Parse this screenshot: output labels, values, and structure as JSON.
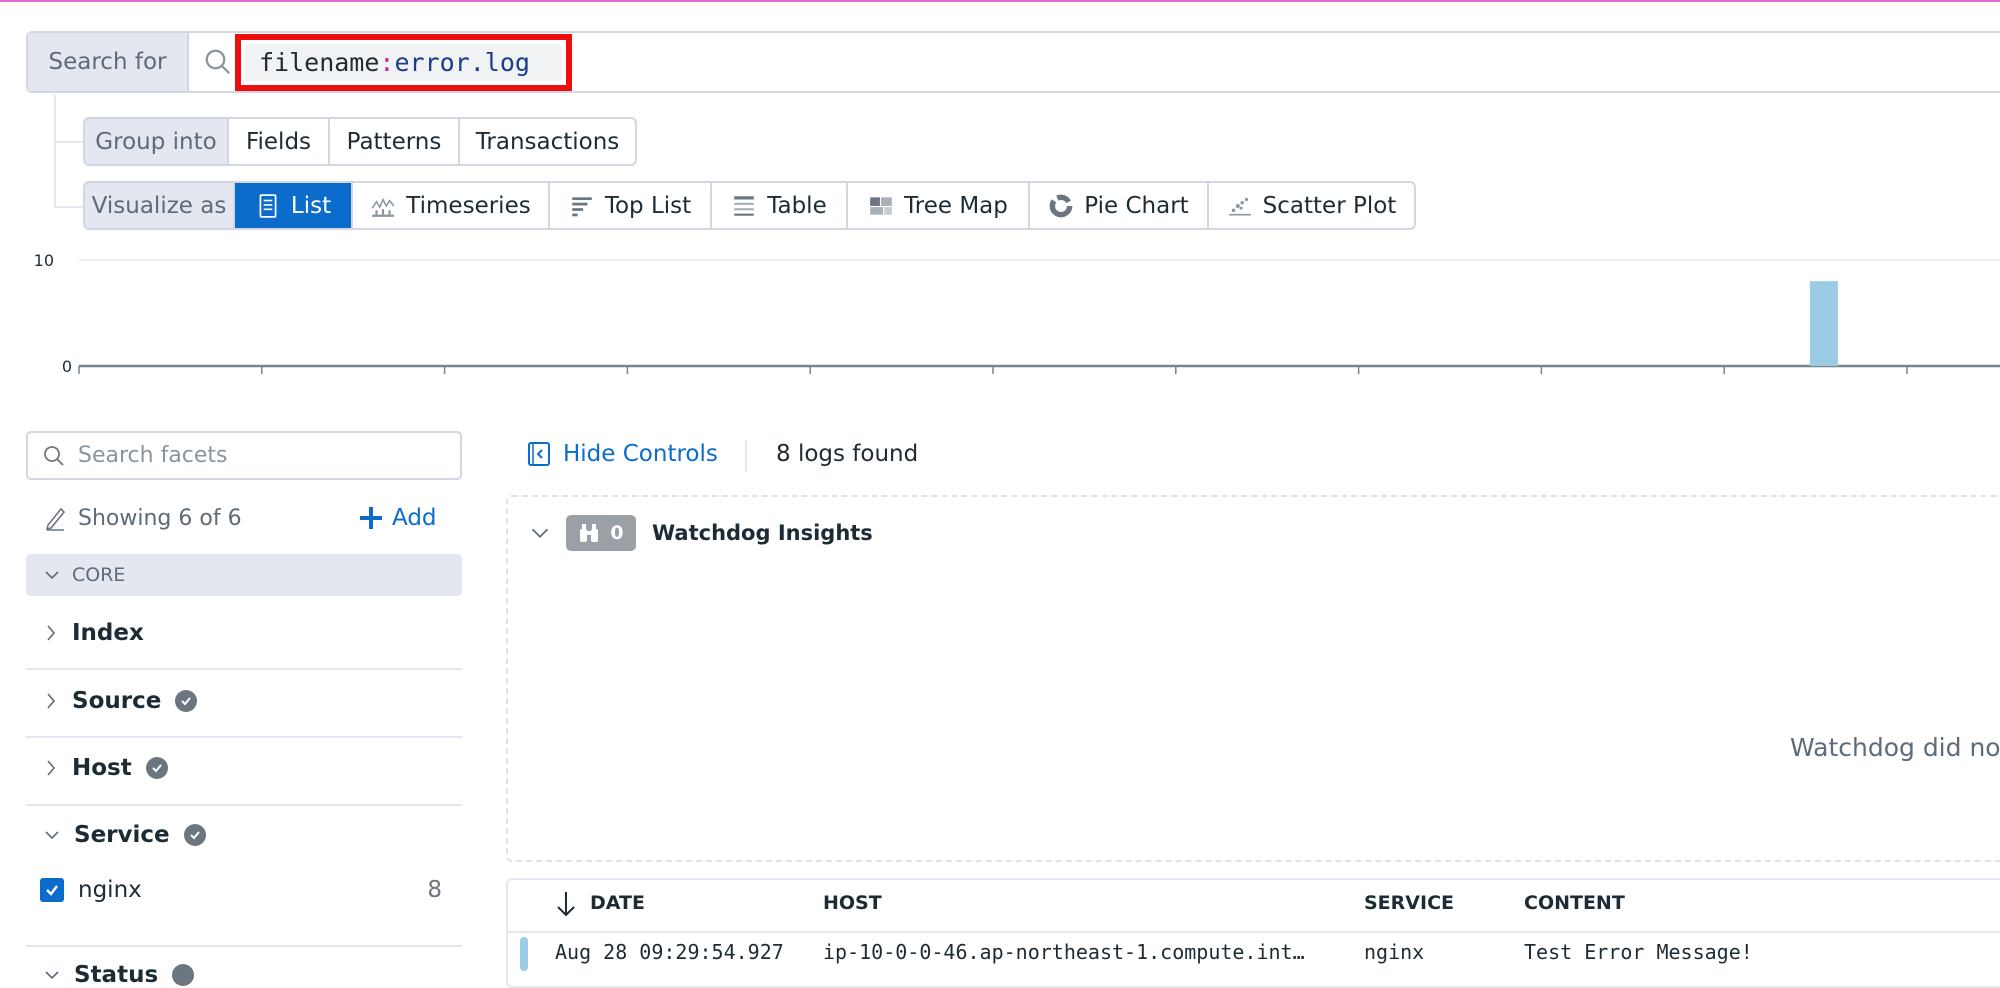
{
  "search": {
    "label": "Search for",
    "query_key": "filename",
    "query_sep": ":",
    "query_value": "error.log"
  },
  "group_into": {
    "label": "Group into",
    "options": [
      "Fields",
      "Patterns",
      "Transactions"
    ]
  },
  "visualize_as": {
    "label": "Visualize as",
    "selected": "List",
    "options": [
      {
        "label": "List",
        "icon": "list-icon"
      },
      {
        "label": "Timeseries",
        "icon": "timeseries-icon"
      },
      {
        "label": "Top List",
        "icon": "top-list-icon"
      },
      {
        "label": "Table",
        "icon": "table-icon"
      },
      {
        "label": "Tree Map",
        "icon": "tree-map-icon"
      },
      {
        "label": "Pie Chart",
        "icon": "pie-chart-icon"
      },
      {
        "label": "Scatter Plot",
        "icon": "scatter-plot-icon"
      }
    ]
  },
  "chart_data": {
    "type": "bar",
    "y_ticks": [
      "10",
      "0"
    ],
    "ylim": [
      0,
      10
    ],
    "x_tick_count": 11,
    "values": [
      8
    ],
    "bar_position_fraction": 0.9,
    "bar_color": "#9ccbe6",
    "grid": true
  },
  "facets": {
    "search_placeholder": "Search facets",
    "showing": "Showing 6 of 6",
    "add_label": "Add",
    "group": "CORE",
    "items": [
      {
        "label": "Index",
        "verified": false,
        "expanded": false
      },
      {
        "label": "Source",
        "verified": true,
        "expanded": false
      },
      {
        "label": "Host",
        "verified": true,
        "expanded": false
      },
      {
        "label": "Service",
        "verified": true,
        "expanded": true
      },
      {
        "label": "Status",
        "verified": true,
        "expanded": false
      }
    ],
    "service_values": [
      {
        "label": "nginx",
        "count": "8",
        "checked": true
      }
    ]
  },
  "results": {
    "hide_controls": "Hide Controls",
    "count_text": "8 logs found",
    "watchdog": {
      "title": "Watchdog Insights",
      "count": "0",
      "message": "Watchdog did no"
    },
    "columns": [
      "DATE",
      "HOST",
      "SERVICE",
      "CONTENT"
    ],
    "rows": [
      {
        "date": "Aug 28 09:29:54.927",
        "host": "ip-10-0-0-46.ap-northeast-1.compute.int…",
        "service": "nginx",
        "content": "Test Error Message!"
      }
    ]
  },
  "colors": {
    "accent": "#0b6ccb",
    "highlight_box": "#ee0e0e",
    "bar": "#9ccbe6"
  }
}
